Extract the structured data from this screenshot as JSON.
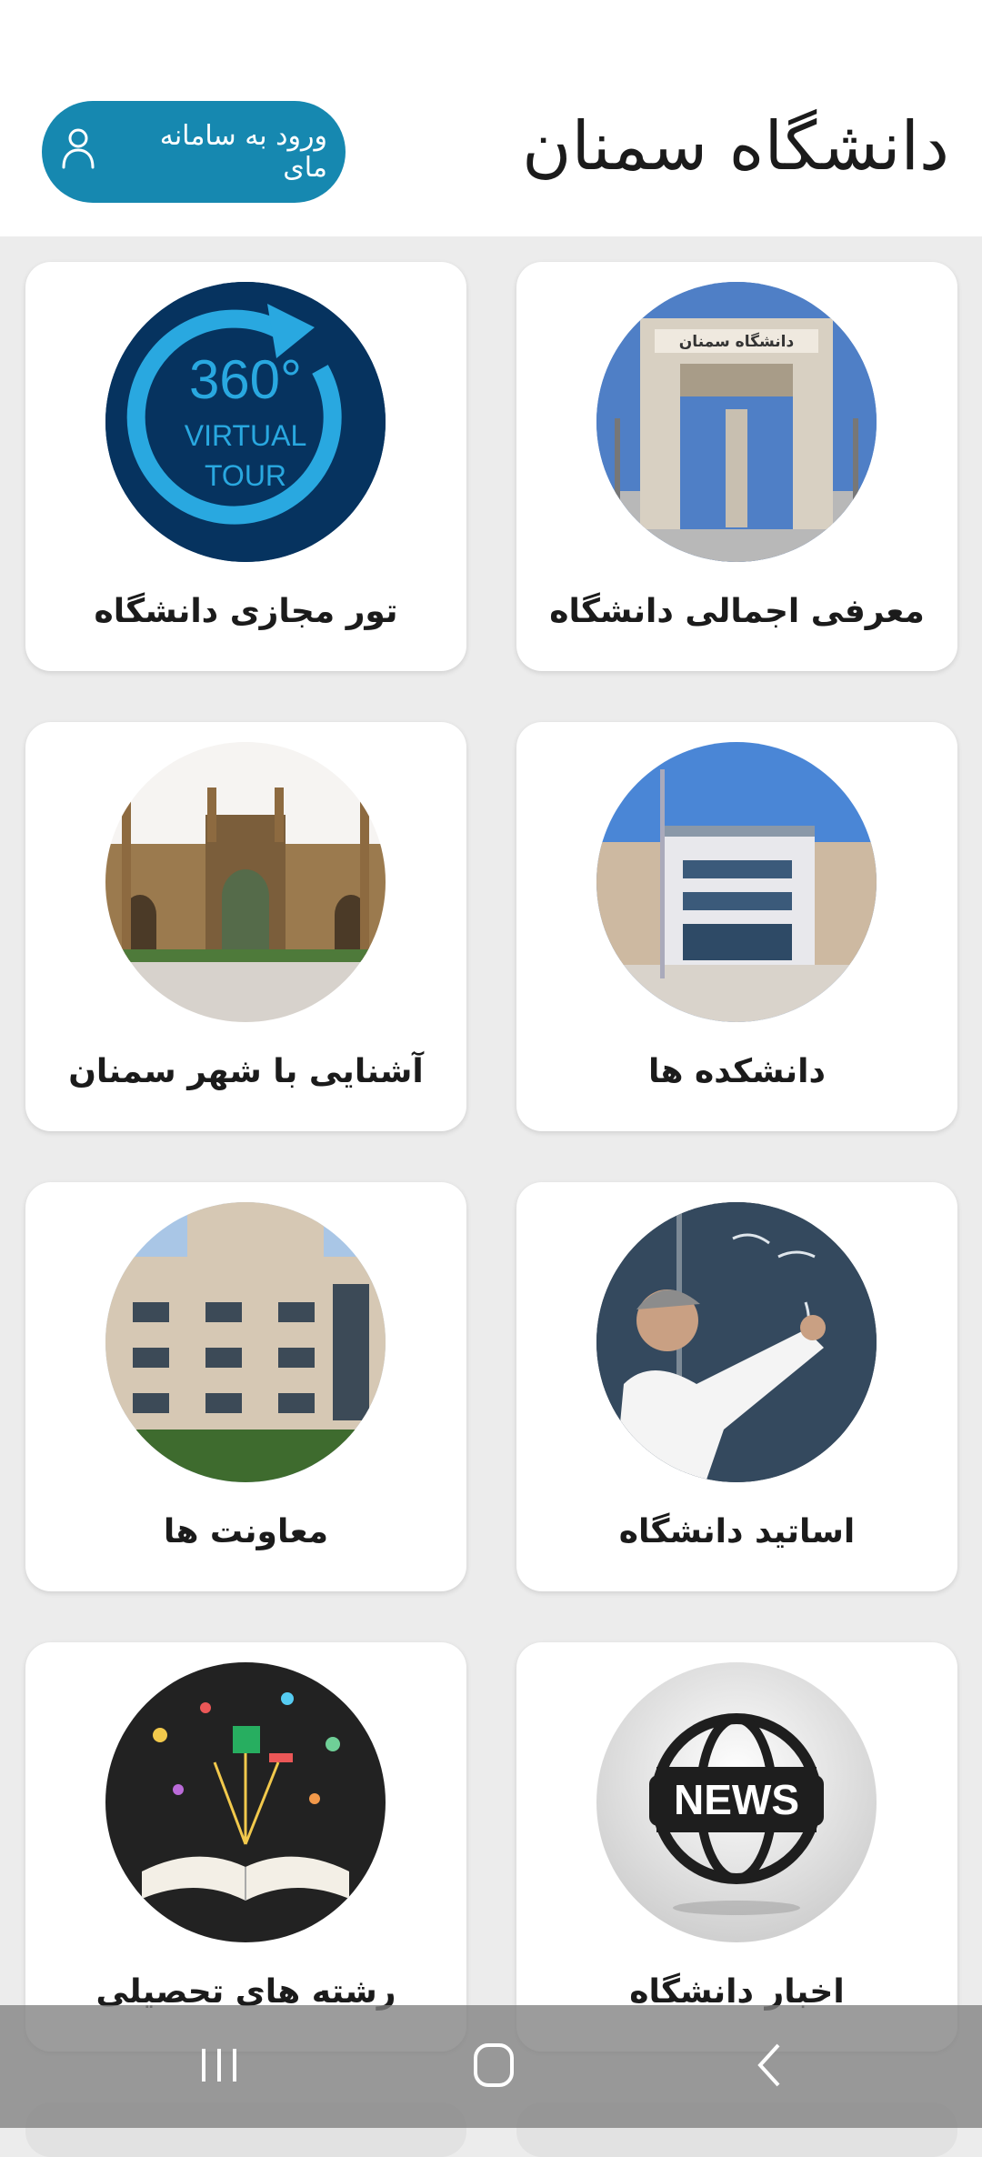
{
  "header": {
    "title": "دانشگاه سمنان",
    "login_label": "ورود به سامانه مای",
    "accent_color": "#1688b0"
  },
  "cards": [
    {
      "label": "معرفی اجمالی دانشگاه",
      "icon": "university-gate-photo"
    },
    {
      "label": "تور مجازی دانشگاه",
      "icon": "virtual-tour-360-icon"
    },
    {
      "label": "دانشکده ها",
      "icon": "faculty-building-photo"
    },
    {
      "label": "آشنایی با شهر سمنان",
      "icon": "semnan-gate-photo"
    },
    {
      "label": "اساتید دانشگاه",
      "icon": "professor-blackboard-photo"
    },
    {
      "label": "معاونت ها",
      "icon": "office-building-photo"
    },
    {
      "label": "اخبار دانشگاه",
      "icon": "news-globe-icon"
    },
    {
      "label": "رشته های تحصیلی",
      "icon": "open-book-icon"
    }
  ],
  "tour_badge": {
    "number": "360°",
    "line1": "VIRTUAL",
    "line2": "TOUR"
  },
  "news_badge": {
    "text": "NEWS"
  },
  "gate_sign": {
    "text": "دانشگاه سمنان"
  },
  "navbar": {
    "buttons": [
      "recent-apps",
      "home",
      "back"
    ]
  }
}
